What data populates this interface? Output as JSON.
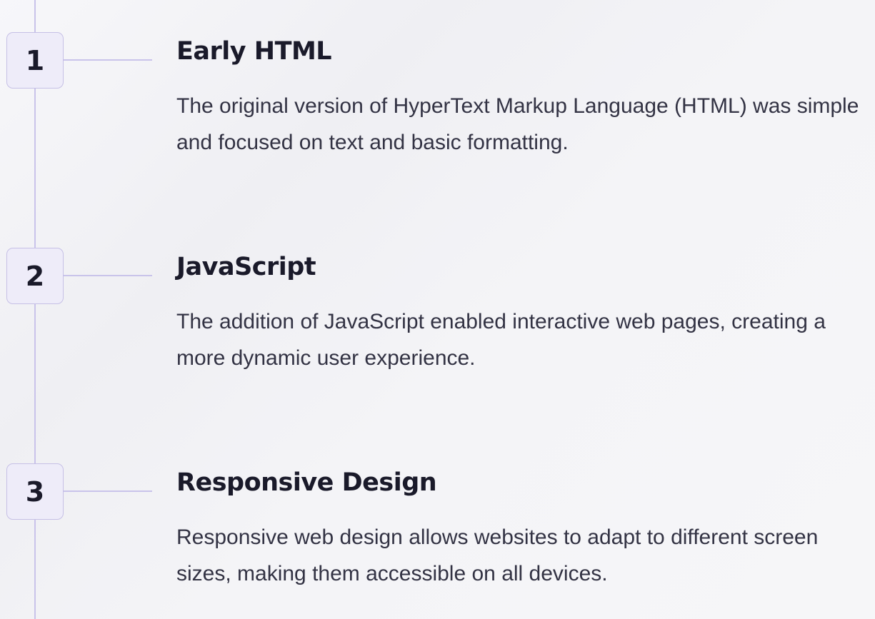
{
  "timeline": {
    "steps": [
      {
        "number": "1",
        "title": "Early HTML",
        "description": "The original version of HyperText Markup Language (HTML) was simple and focused on text and basic formatting."
      },
      {
        "number": "2",
        "title": "JavaScript",
        "description": "The addition of JavaScript enabled interactive web pages, creating a more dynamic user experience."
      },
      {
        "number": "3",
        "title": "Responsive Design",
        "description": "Responsive web design allows websites to adapt to different screen sizes, making them accessible on all devices."
      }
    ]
  }
}
